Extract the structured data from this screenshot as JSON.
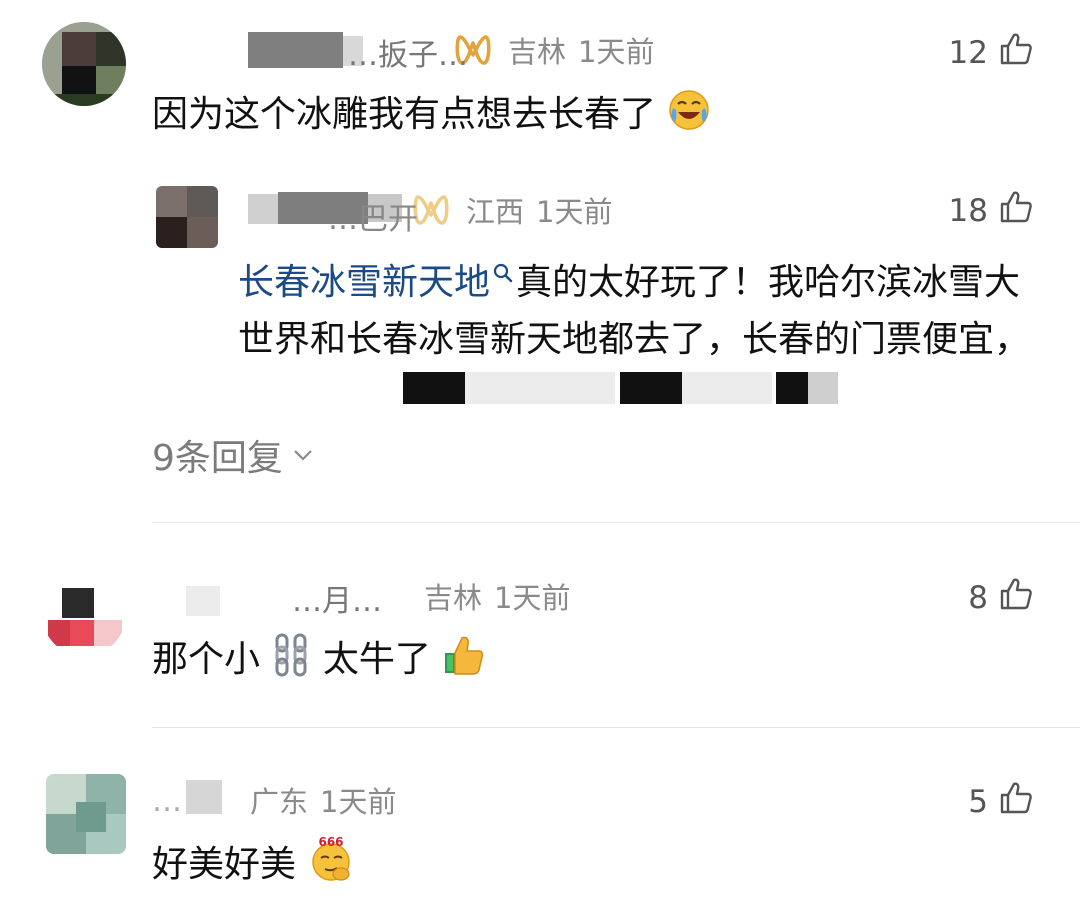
{
  "comments": [
    {
      "user_name": "…扳子…",
      "location": "吉林",
      "time": "1天前",
      "likes": "12",
      "text": "因为这个冰雕我有点想去长春了",
      "text_emoji": "laughing-crying-emoji",
      "reply": {
        "user_name": "…巴开",
        "location": "江西",
        "time": "1天前",
        "likes": "18",
        "topic": "长春冰雪新天地",
        "text": "真的太好玩了！我哈尔滨冰雪大世界和长春冰雪新天地都去了，长春的门票便宜，"
      },
      "more_replies": "9条回复"
    },
    {
      "user_name": "…月…",
      "location": "吉林",
      "time": "1天前",
      "likes": "8",
      "text_before": "那个小",
      "text_chain": "⛓",
      "text_after": "太牛了",
      "text_emoji": "thumbs-up-emoji"
    },
    {
      "user_name": "…",
      "location": "广东",
      "time": "1天前",
      "likes": "5",
      "text": "好美好美",
      "text_emoji": "666-emoji"
    }
  ],
  "icons": {
    "like": "thumbs-up-outline-icon",
    "vip": "vip-badge-icon",
    "chevron": "chevron-down-icon",
    "search": "search-icon"
  },
  "colors": {
    "topic_link": "#1b4a86",
    "meta_text": "#8a8a8a",
    "vip_gold": "#e3a33c"
  }
}
